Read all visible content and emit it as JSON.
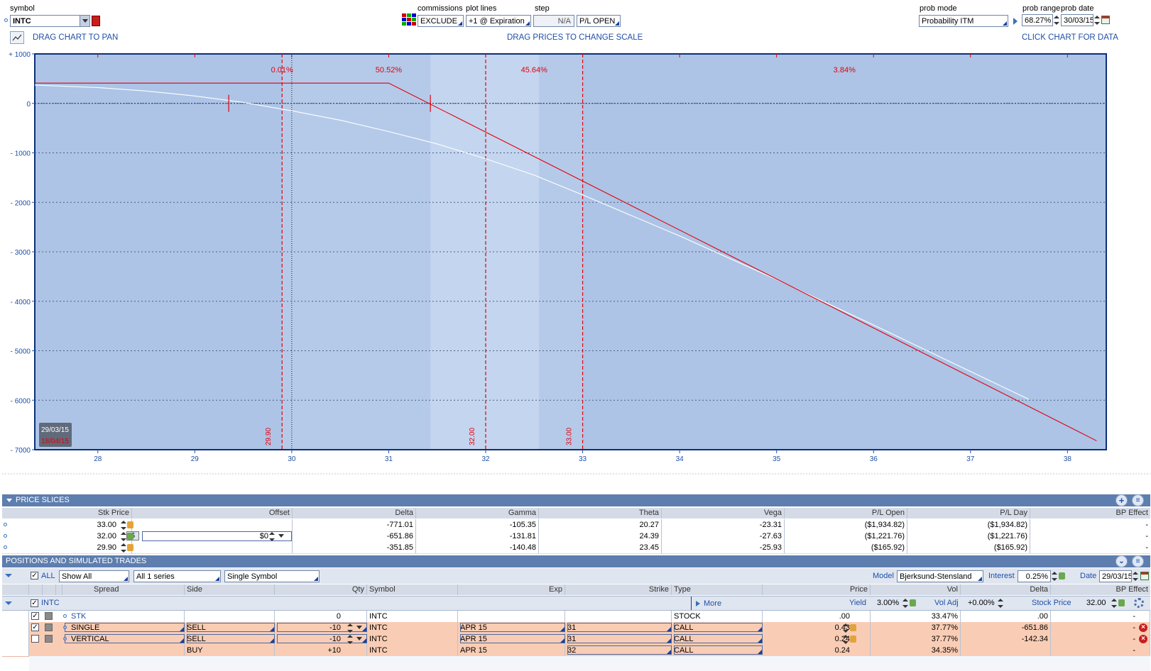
{
  "top": {
    "symbol_label": "symbol",
    "symbol_value": "INTC",
    "commissions_label": "commissions",
    "commissions_value": "EXCLUDE",
    "plotlines_label": "plot lines",
    "plotlines_value": "+1 @ Expiration",
    "step_label": "step",
    "step_value": "N/A",
    "pl_value": "P/L OPEN",
    "probmode_label": "prob mode",
    "probmode_value": "Probability ITM",
    "probrange_label": "prob range",
    "probrange_value": "68.27%",
    "probdate_label": "prob date",
    "probdate_value": "30/03/15",
    "drag_pan": "DRAG CHART TO PAN",
    "drag_prices": "DRAG PRICES TO CHANGE SCALE",
    "click_chart": "CLICK CHART FOR DATA"
  },
  "chart_data": {
    "type": "line",
    "xlim": [
      27.35,
      38.4
    ],
    "ylim": [
      -7000,
      1000
    ],
    "y_ticks": [
      "+ 1000",
      "0",
      "- 1000",
      "- 2000",
      "- 3000",
      "- 4000",
      "- 5000",
      "- 6000",
      "- 7000"
    ],
    "x_ticks": [
      "28",
      "29",
      "30",
      "31",
      "32",
      "33",
      "34",
      "35",
      "36",
      "37",
      "38"
    ],
    "bands": [
      {
        "label": "0.01%",
        "x": 29.9
      },
      {
        "label": "50.52%",
        "x": 31.0
      },
      {
        "label": "45.64%",
        "x": 32.5
      },
      {
        "label": "3.84%",
        "x": 35.7
      }
    ],
    "price_lines": [
      {
        "label": "29.90",
        "x": 29.9
      },
      {
        "label": "32.00",
        "x": 32.0
      },
      {
        "label": "33.00",
        "x": 33.0
      }
    ],
    "current_price": 30.0,
    "std_range": [
      31.43,
      32.55
    ],
    "date_today": "29/03/15",
    "date_expiry": "18/04/15",
    "series": [
      {
        "name": "29/03/15",
        "color": "#ffffff",
        "x": [
          27.35,
          28.0,
          28.5,
          29.0,
          29.5,
          30.0,
          30.5,
          31.0,
          31.5,
          32.0,
          32.5,
          33.0,
          34.0,
          35.0,
          36.0,
          37.0,
          37.6
        ],
        "y": [
          370,
          320,
          250,
          150,
          20,
          -150,
          -340,
          -570,
          -820,
          -1120,
          -1450,
          -1850,
          -2680,
          -3560,
          -4480,
          -5420,
          -5980
        ]
      },
      {
        "name": "18/04/15",
        "color": "#e3000b",
        "x": [
          27.35,
          31.0,
          32.0,
          33.0,
          34.0,
          35.0,
          36.0,
          37.0,
          38.3
        ],
        "y": [
          410,
          410,
          -580,
          -1570,
          -2560,
          -3550,
          -4540,
          -5530,
          -6820
        ]
      }
    ]
  },
  "slices": {
    "title": "PRICE SLICES",
    "headers": [
      "Stk Price",
      "Offset",
      "Delta",
      "Gamma",
      "Theta",
      "Vega",
      "P/L Open",
      "P/L Day",
      "BP Effect"
    ],
    "rows": [
      {
        "price": "33.00",
        "offset": "",
        "delta": "-771.01",
        "gamma": "-105.35",
        "theta": "20.27",
        "vega": "-23.31",
        "plopen": "($1,934.82)",
        "plday": "($1,934.82)",
        "bp": "-"
      },
      {
        "price": "32.00",
        "offset": "$0",
        "delta": "-651.86",
        "gamma": "-131.81",
        "theta": "24.39",
        "vega": "-27.63",
        "plopen": "($1,221.76)",
        "plday": "($1,221.76)",
        "bp": "-"
      },
      {
        "price": "29.90",
        "offset": "",
        "delta": "-351.85",
        "gamma": "-140.48",
        "theta": "23.45",
        "vega": "-25.93",
        "plopen": "($165.92)",
        "plday": "($165.92)",
        "bp": "-"
      }
    ]
  },
  "positions": {
    "title": "POSITIONS AND SIMULATED TRADES",
    "all_label": "ALL",
    "show": "Show All",
    "series": "All 1 series",
    "single": "Single Symbol",
    "model_label": "Model",
    "model_value": "Bjerksund-Stensland",
    "interest_label": "Interest",
    "interest_value": "0.25%",
    "date_label": "Date",
    "date_value": "29/03/15",
    "headers": [
      "Spread",
      "Side",
      "Qty",
      "Symbol",
      "Exp",
      "Strike",
      "Type",
      "Price",
      "Vol",
      "Delta",
      "BP Effect"
    ],
    "group": "INTC",
    "more": "More",
    "yield_label": "Yield",
    "yield_value": "3.00%",
    "voladj_label": "Vol Adj",
    "voladj_value": "+0.00%",
    "stockprice_label": "Stock Price",
    "stockprice_value": "32.00",
    "rows": [
      {
        "spread": "STK",
        "side": "",
        "qty": "0",
        "symbol": "INTC",
        "exp": "",
        "strike": "",
        "type": "STOCK",
        "price": ".00",
        "vol": "33.47%",
        "delta": ".00",
        "bp": "-"
      },
      {
        "spread": "SINGLE",
        "side": "SELL",
        "qty": "-10",
        "symbol": "INTC",
        "exp": "APR 15",
        "strike": "31",
        "type": "CALL",
        "price": "0.43",
        "vol": "37.77%",
        "delta": "-651.86",
        "bp": "-"
      },
      {
        "spread": "VERTICAL",
        "side": "SELL",
        "qty": "-10",
        "symbol": "INTC",
        "exp": "APR 15",
        "strike": "31",
        "type": "CALL",
        "price": "0.24",
        "vol": "37.77%",
        "delta": "-142.34",
        "bp": "-"
      },
      {
        "spread": "",
        "side": "BUY",
        "qty": "+10",
        "symbol": "INTC",
        "exp": "APR 15",
        "strike": "32",
        "type": "CALL",
        "price": "0.24",
        "vol": "34.35%",
        "delta": "",
        "bp": "-"
      }
    ]
  }
}
